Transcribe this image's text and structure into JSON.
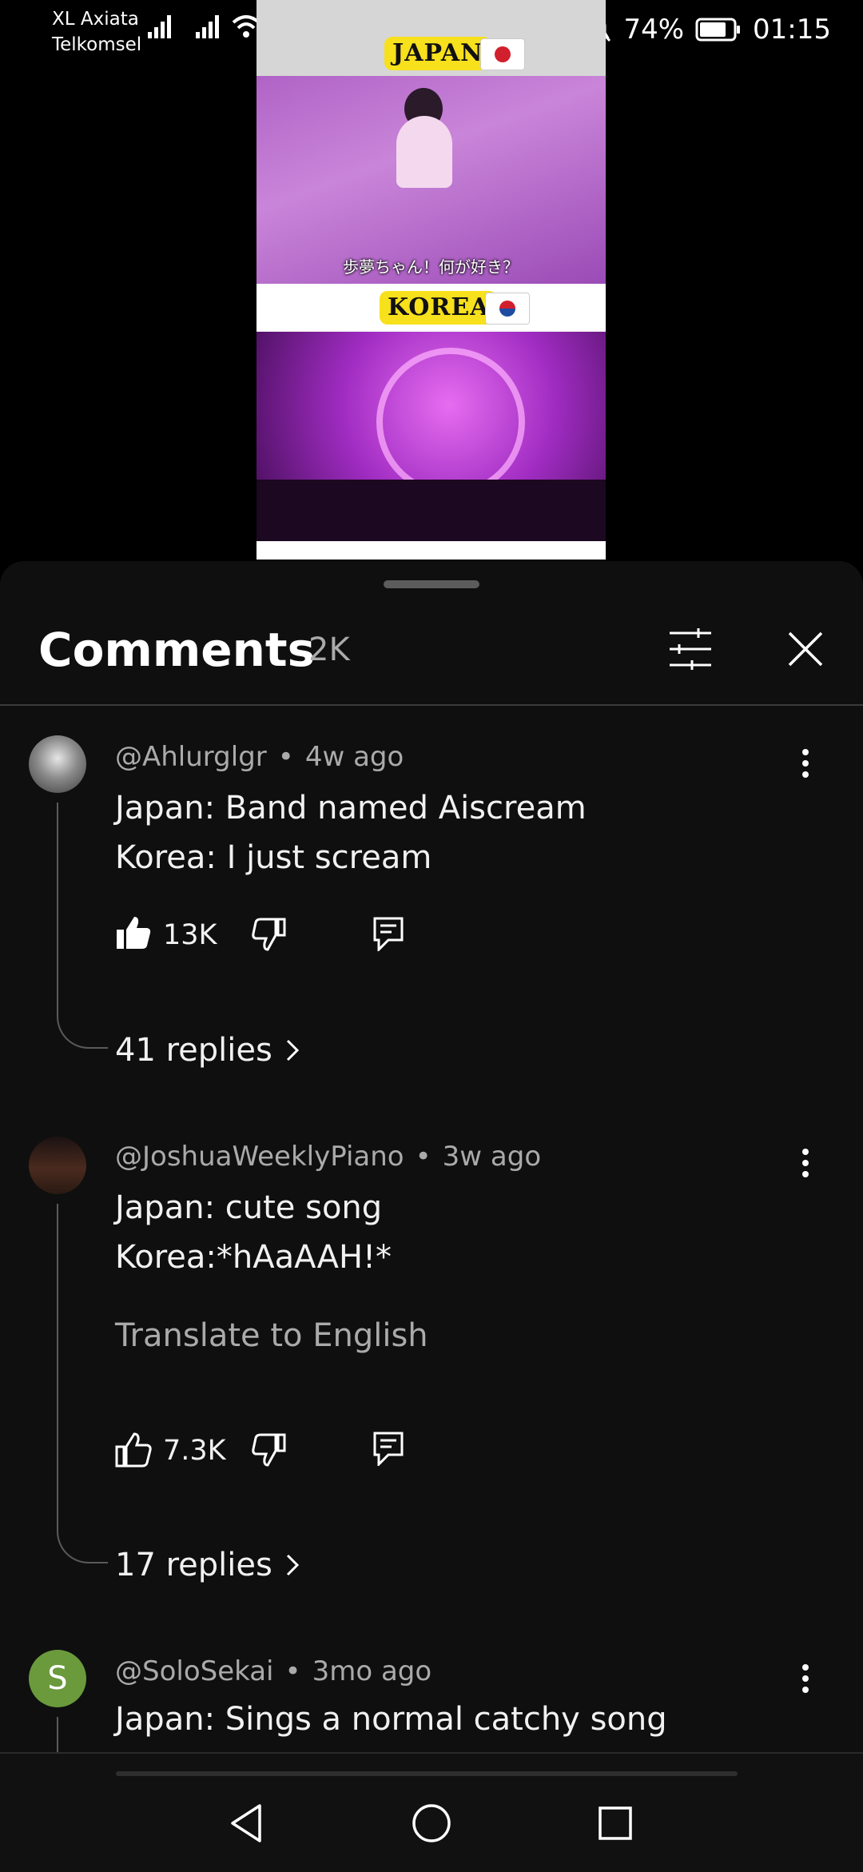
{
  "status_bar": {
    "carrier_1": "XL Axiata",
    "carrier_2": "Telkomsel",
    "battery": "74%",
    "time": "01:15"
  },
  "video": {
    "label_top": "JAPAN",
    "label_bottom": "KOREA",
    "subtitle": "歩夢ちゃん！何が好き？"
  },
  "comments_panel": {
    "title": "Comments",
    "count": "2K"
  },
  "comments": [
    {
      "author": "@Ahlurglgr",
      "age": "4w ago",
      "lines": [
        "Japan: Band named Aiscream",
        "Korea: I just scream"
      ],
      "likes": "13K",
      "replies": "41 replies"
    },
    {
      "author": "@JoshuaWeeklyPiano",
      "age": "3w ago",
      "lines": [
        "Japan: cute song",
        "Korea:*hAaAAH!*"
      ],
      "translate": "Translate to English",
      "likes": "7.3K",
      "replies": "17 replies"
    },
    {
      "author": "@SoloSekai",
      "age": "3mo ago",
      "avatar_letter": "S",
      "avatar_color": "#6a9a3c",
      "lines": [
        "Japan: Sings a normal catchy song"
      ]
    }
  ],
  "colors": {
    "background": "#0f0f0f",
    "secondary_text": "#aaaaaa",
    "badge_yellow": "#f7e01c"
  }
}
